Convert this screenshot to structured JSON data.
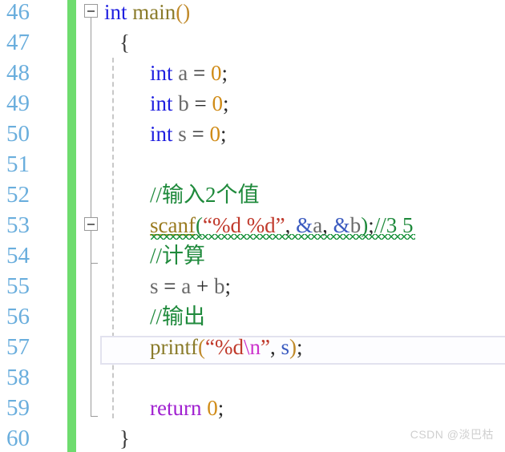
{
  "editor": {
    "first_line_number": 46,
    "last_line_number": 60,
    "current_line_number": 57,
    "colors": {
      "change_bar_green": "#6edc6e",
      "line_number": "#6aaedd",
      "keyword_blue": "#1f1fe0",
      "comment_green": "#1f8a3c",
      "string_red": "#c0392b",
      "number_orange": "#d08b16",
      "escape_magenta": "#cc33cc",
      "return_purple": "#a020d0",
      "identifier_gray": "#6a6a6a",
      "error_squiggle_green": "#17913a",
      "current_line_border": "#e2e2ef"
    }
  },
  "gutter": {
    "line_numbers": [
      "46",
      "47",
      "48",
      "49",
      "50",
      "51",
      "52",
      "53",
      "54",
      "55",
      "56",
      "57",
      "58",
      "59",
      "60"
    ]
  },
  "outlining": {
    "fold_markers": [
      {
        "line": 46,
        "state": "expanded",
        "glyph": "minus"
      },
      {
        "line": 53,
        "state": "expanded",
        "glyph": "minus"
      }
    ]
  },
  "code": {
    "lines": [
      {
        "number": "46",
        "indent": 0,
        "tokens": [
          {
            "text": "int",
            "cls": "t-keyword"
          },
          {
            "text": " ",
            "cls": "t-plain"
          },
          {
            "text": "main",
            "cls": "t-fname"
          },
          {
            "text": "()",
            "cls": "t-paren2"
          }
        ]
      },
      {
        "number": "47",
        "indent": 1,
        "tokens": [
          {
            "text": "{",
            "cls": "t-brace"
          }
        ]
      },
      {
        "number": "48",
        "indent": 3,
        "tokens": [
          {
            "text": "int",
            "cls": "t-keyword"
          },
          {
            "text": " ",
            "cls": "t-plain"
          },
          {
            "text": "a",
            "cls": "t-ident"
          },
          {
            "text": " = ",
            "cls": "t-plain"
          },
          {
            "text": "0",
            "cls": "t-num"
          },
          {
            "text": ";",
            "cls": "t-plain"
          }
        ]
      },
      {
        "number": "49",
        "indent": 3,
        "tokens": [
          {
            "text": "int",
            "cls": "t-keyword"
          },
          {
            "text": " ",
            "cls": "t-plain"
          },
          {
            "text": "b",
            "cls": "t-ident"
          },
          {
            "text": " = ",
            "cls": "t-plain"
          },
          {
            "text": "0",
            "cls": "t-num"
          },
          {
            "text": ";",
            "cls": "t-plain"
          }
        ]
      },
      {
        "number": "50",
        "indent": 3,
        "tokens": [
          {
            "text": "int",
            "cls": "t-keyword"
          },
          {
            "text": " ",
            "cls": "t-plain"
          },
          {
            "text": "s",
            "cls": "t-ident"
          },
          {
            "text": " = ",
            "cls": "t-plain"
          },
          {
            "text": "0",
            "cls": "t-num"
          },
          {
            "text": ";",
            "cls": "t-plain"
          }
        ]
      },
      {
        "number": "51",
        "indent": 0,
        "tokens": []
      },
      {
        "number": "52",
        "indent": 3,
        "tokens": [
          {
            "text": "//输入2个值",
            "cls": "t-comment"
          }
        ]
      },
      {
        "number": "53",
        "indent": 3,
        "tokens": [
          {
            "text": "scanf",
            "cls": "t-func"
          },
          {
            "text": "(",
            "cls": "t-paren"
          },
          {
            "text": "“%d %d”",
            "cls": "t-str"
          },
          {
            "text": ", ",
            "cls": "t-plain"
          },
          {
            "text": "&",
            "cls": "t-amp"
          },
          {
            "text": "a",
            "cls": "t-ident"
          },
          {
            "text": ", ",
            "cls": "t-plain"
          },
          {
            "text": "&",
            "cls": "t-amp"
          },
          {
            "text": "b",
            "cls": "t-ident"
          },
          {
            "text": ")",
            "cls": "t-paren"
          },
          {
            "text": ";",
            "cls": "t-plain"
          },
          {
            "text": "//3 5",
            "cls": "t-comment"
          }
        ]
      },
      {
        "number": "54",
        "indent": 3,
        "tokens": [
          {
            "text": "//计算",
            "cls": "t-comment"
          }
        ]
      },
      {
        "number": "55",
        "indent": 3,
        "tokens": [
          {
            "text": "s",
            "cls": "t-ident"
          },
          {
            "text": " = ",
            "cls": "t-plain"
          },
          {
            "text": "a",
            "cls": "t-ident"
          },
          {
            "text": " + ",
            "cls": "t-plain"
          },
          {
            "text": "b",
            "cls": "t-ident"
          },
          {
            "text": ";",
            "cls": "t-plain"
          }
        ]
      },
      {
        "number": "56",
        "indent": 3,
        "tokens": [
          {
            "text": "//输出",
            "cls": "t-comment"
          }
        ]
      },
      {
        "number": "57",
        "indent": 3,
        "tokens": [
          {
            "text": "printf",
            "cls": "t-fname"
          },
          {
            "text": "(",
            "cls": "t-paren2"
          },
          {
            "text": "“%d",
            "cls": "t-str"
          },
          {
            "text": "\\n",
            "cls": "t-esc"
          },
          {
            "text": "”",
            "cls": "t-str"
          },
          {
            "text": ", ",
            "cls": "t-plain"
          },
          {
            "text": "s",
            "cls": "t-amp"
          },
          {
            "text": ")",
            "cls": "t-paren2"
          },
          {
            "text": ";",
            "cls": "t-plain"
          }
        ]
      },
      {
        "number": "58",
        "indent": 0,
        "tokens": []
      },
      {
        "number": "59",
        "indent": 3,
        "tokens": [
          {
            "text": "return",
            "cls": "t-return"
          },
          {
            "text": " ",
            "cls": "t-plain"
          },
          {
            "text": "0",
            "cls": "t-num"
          },
          {
            "text": ";",
            "cls": "t-plain"
          }
        ]
      },
      {
        "number": "60",
        "indent": 1,
        "tokens": [
          {
            "text": "}",
            "cls": "t-brace"
          }
        ]
      }
    ]
  },
  "watermark": {
    "text": "CSDN @淡巴枯"
  }
}
